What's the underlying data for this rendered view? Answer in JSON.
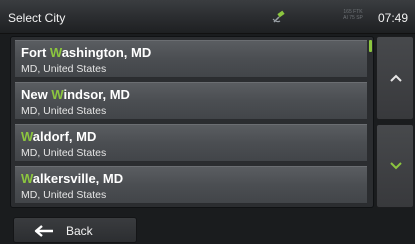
{
  "header": {
    "title": "Select City",
    "time": "07:49",
    "speed_text": "165 FTK\nAI 75 SP"
  },
  "cities": [
    {
      "highlight": "",
      "name_rest": "Fort ",
      "hl": "W",
      "name_end": "ashington, MD",
      "subtitle": "MD, United States"
    },
    {
      "name_rest": "New ",
      "hl": "W",
      "name_end": "indsor, MD",
      "subtitle": "MD, United States"
    },
    {
      "name_rest": "",
      "hl": "W",
      "name_end": "aldorf, MD",
      "subtitle": "MD, United States"
    },
    {
      "name_rest": "",
      "hl": "W",
      "name_end": "alkersville, MD",
      "subtitle": "MD, United States"
    }
  ],
  "footer": {
    "back_label": "Back"
  },
  "colors": {
    "highlight": "#8cc63f",
    "row": "#4b4e52",
    "background": "#1a1c1e"
  },
  "icons": {
    "gps": "satellite-icon",
    "scroll_up": "chevron-up-icon",
    "scroll_down": "chevron-down-icon",
    "back": "arrow-left-icon"
  }
}
